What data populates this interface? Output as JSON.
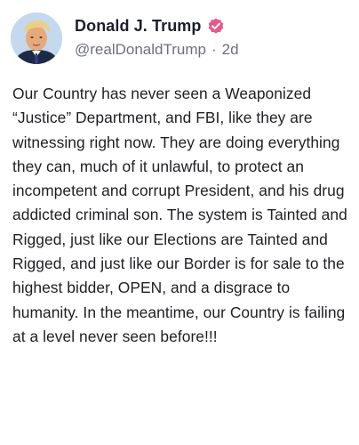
{
  "post": {
    "author": {
      "display_name": "Donald J. Trump",
      "handle": "@realDonaldTrump",
      "separator": "·",
      "time_ago": "2d",
      "verified_icon": "verified-badge-icon",
      "avatar_icon": "profile-photo"
    },
    "text": "Our Country has never seen a Weaponized “Justice” Department, and FBI, like they are witnessing right now. They are doing everything they can, much of it unlawful, to protect an incompetent and corrupt President, and his drug addicted criminal son. The system is Tainted and Rigged, just like our Elections are Tainted and Rigged, and just like our Border is for sale to the highest bidder, OPEN, and a disgrace to humanity. In the meantime, our Country is failing at a level never seen before!!!"
  },
  "colors": {
    "verified": "#e8588a",
    "name": "#1b1f2a",
    "handle": "#6b7079",
    "text": "#1f2024"
  }
}
